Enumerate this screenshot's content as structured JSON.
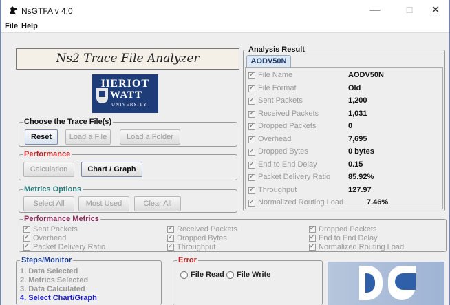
{
  "window": {
    "title": "NsGTFA v 4.0",
    "minimize": "—",
    "maximize": "☐",
    "close": "✕"
  },
  "menu": {
    "file": "File",
    "help": "Help"
  },
  "banner": {
    "text": "Ns2 Trace File Analyzer"
  },
  "university_logo": {
    "line1": "HERIOT",
    "line2": "WATT",
    "line3": "UNIVERSITY"
  },
  "trace_files": {
    "title": "Choose the Trace File(s)",
    "reset": "Reset",
    "load_file": "Load a File",
    "load_folder": "Load a Folder"
  },
  "performance": {
    "title": "Performance",
    "calculation": "Calculation",
    "chart_graph": "Chart / Graph"
  },
  "metrics_options": {
    "title": "Metrics Options",
    "select_all": "Select All",
    "most_used": "Most Used",
    "clear_all": "Clear All"
  },
  "analysis": {
    "title": "Analysis Result",
    "tab": "AODV50N",
    "rows": [
      {
        "label": "File Name",
        "value": "AODV50N"
      },
      {
        "label": "File Format",
        "value": "Old"
      },
      {
        "label": "Sent Packets",
        "value": "1,200"
      },
      {
        "label": "Received Packets",
        "value": "1,031"
      },
      {
        "label": "Dropped Packets",
        "value": "0"
      },
      {
        "label": "Overhead",
        "value": "7,695"
      },
      {
        "label": "Dropped Bytes",
        "value": "0 bytes"
      },
      {
        "label": "End to End Delay",
        "value": "0.15"
      },
      {
        "label": "Packet Delivery Ratio",
        "value": "85.92%"
      },
      {
        "label": "Throughput",
        "value": "127.97"
      },
      {
        "label": "Normalized Routing Load",
        "value": "7.46%"
      }
    ]
  },
  "performance_metrics": {
    "title": "Performance Metrics",
    "items": [
      "Sent Packets",
      "Overhead",
      "Packet Delivery Ratio",
      "Received Packets",
      "Dropped Bytes",
      "Throughput",
      "Dropped Packets",
      "End to End Delay",
      "Normalized Routing Load"
    ]
  },
  "steps": {
    "title": "Steps/Monitor",
    "items": [
      "1. Data Selected",
      "2. Metrics Selected",
      "3. Data Calculated",
      "4. Select Chart/Graph"
    ]
  },
  "error": {
    "title": "Error",
    "file_read": "File Read",
    "file_write": "File Write"
  }
}
